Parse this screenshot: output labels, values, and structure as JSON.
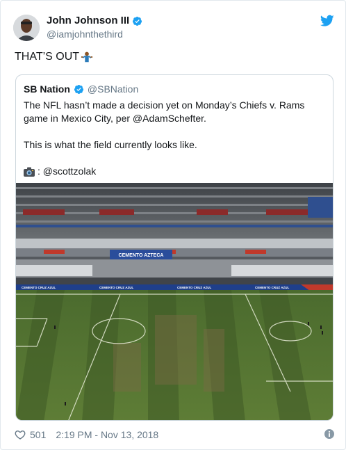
{
  "tweet": {
    "author_name": "John Johnson III",
    "author_handle": "@iamjohnthethird",
    "text": "THAT’S OUT",
    "emoji": "person-shrugging-emoji",
    "likes": "501",
    "timestamp": "2:19 PM - Nov 13, 2018"
  },
  "quote": {
    "author_name": "SB Nation",
    "author_handle": "@SBNation",
    "line1": "The NFL hasn’t made a decision yet on Monday’s Chiefs v. Rams game in Mexico City, per @AdamSchefter.",
    "line2": "This is what the field currently looks like.",
    "photo_credit": ": @scottzolak"
  },
  "stadium": {
    "sponsor_banner": "CEMENTO AZTECA",
    "ad_board": "CEMENTO CRUZ AZUL"
  },
  "icons": {
    "verified": "verified-badge-icon",
    "brand": "twitter-bird-icon",
    "camera": "camera-icon",
    "like": "heart-icon",
    "info": "info-icon"
  },
  "colors": {
    "verified": "#1da1f2",
    "twitter_blue": "#1da1f2",
    "muted": "#657786",
    "border": "#ccd6dd"
  }
}
